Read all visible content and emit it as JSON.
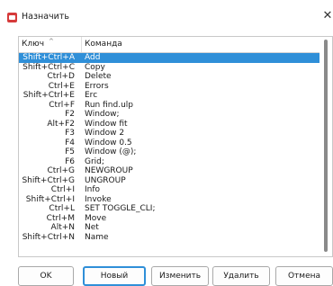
{
  "window": {
    "title": "Назначить",
    "close_glyph": "✕"
  },
  "list": {
    "columns": {
      "key": "Ключ",
      "command": "Команда"
    },
    "sort_glyph": "^",
    "selected_index": 0,
    "rows": [
      {
        "key": "Shift+Ctrl+A",
        "command": "Add"
      },
      {
        "key": "Shift+Ctrl+C",
        "command": "Copy"
      },
      {
        "key": "Ctrl+D",
        "command": "Delete"
      },
      {
        "key": "Ctrl+E",
        "command": "Errors"
      },
      {
        "key": "Shift+Ctrl+E",
        "command": "Erc"
      },
      {
        "key": "Ctrl+F",
        "command": "Run find.ulp"
      },
      {
        "key": "F2",
        "command": "Window;"
      },
      {
        "key": "Alt+F2",
        "command": "Window fit"
      },
      {
        "key": "F3",
        "command": "Window 2"
      },
      {
        "key": "F4",
        "command": "Window 0.5"
      },
      {
        "key": "F5",
        "command": "Window (@);"
      },
      {
        "key": "F6",
        "command": "Grid;"
      },
      {
        "key": "Ctrl+G",
        "command": "NEWGROUP"
      },
      {
        "key": "Shift+Ctrl+G",
        "command": "UNGROUP"
      },
      {
        "key": "Ctrl+I",
        "command": "Info"
      },
      {
        "key": "Shift+Ctrl+I",
        "command": "Invoke"
      },
      {
        "key": "Ctrl+L",
        "command": "SET TOGGLE_CLI;"
      },
      {
        "key": "Ctrl+M",
        "command": "Move"
      },
      {
        "key": "Alt+N",
        "command": "Net"
      },
      {
        "key": "Shift+Ctrl+N",
        "command": "Name"
      }
    ]
  },
  "buttons": {
    "ok": "OK",
    "new": "Новый",
    "edit": "Изменить",
    "delete": "Удалить",
    "cancel": "Отмена"
  },
  "colors": {
    "selection": "#2f8fd8",
    "app_icon": "#d63a3a"
  }
}
